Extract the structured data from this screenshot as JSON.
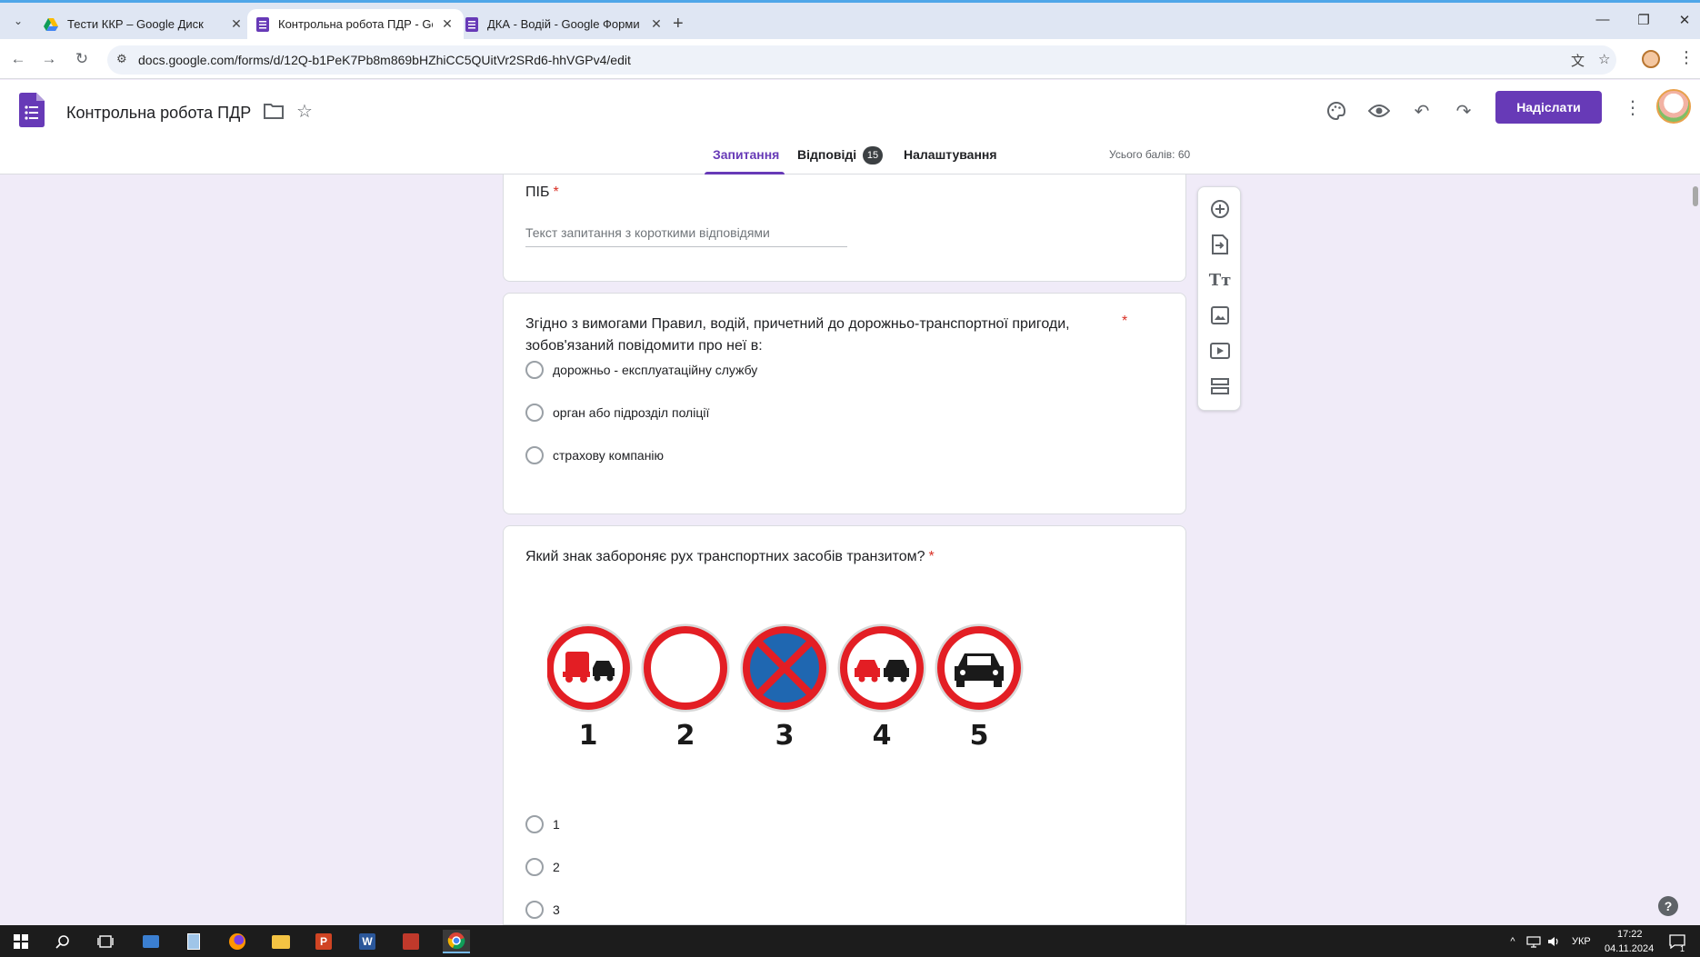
{
  "browser": {
    "tabs": [
      {
        "title": "Тести ККР – Google Диск",
        "icon": "google-drive-icon",
        "active": false
      },
      {
        "title": "Контрольна робота ПДР - Google",
        "icon": "google-forms-icon",
        "active": true
      },
      {
        "title": "ДКА - Водій - Google Форми",
        "icon": "google-forms-icon",
        "active": false
      }
    ],
    "url": "docs.google.com/forms/d/12Q-b1PeK7Pb8m869bHZhiCC5QUitVr2SRd6-hhVGPv4/edit"
  },
  "form_header": {
    "title": "Контрольна робота ПДР",
    "send_label": "Надіслати",
    "tabs": {
      "questions": "Запитання",
      "responses": "Відповіді",
      "responses_count": "15",
      "settings": "Налаштування"
    },
    "total_points": "Усього балів: 60"
  },
  "questions": [
    {
      "title": "ПІБ",
      "required_mark": "*",
      "placeholder": "Текст запитання з короткими відповідями"
    },
    {
      "title_line1": "Згідно з вимогами Правил, водій, причетний до дорожньо-транспортної пригоди,",
      "title_line2": "зобов'язаний повідомити про неї в:",
      "required_mark": "*",
      "options": [
        "дорожньо - експлуатаційну службу",
        "орган або підрозділ поліції",
        "страхову компанію"
      ]
    },
    {
      "title": "Який знак забороняє рух транспортних засобів транзитом?",
      "required_mark": "*",
      "sign_numbers": [
        "1",
        "2",
        "3",
        "4",
        "5"
      ],
      "options": [
        "1",
        "2",
        "3"
      ]
    }
  ],
  "colors": {
    "brand": "#673ab7",
    "background": "#f0ebf8",
    "sign_red": "#e31e24",
    "sign_blue": "#1f67b1"
  },
  "taskbar": {
    "language": "УКР",
    "time": "17:22",
    "date": "04.11.2024",
    "notification_count": "1"
  }
}
